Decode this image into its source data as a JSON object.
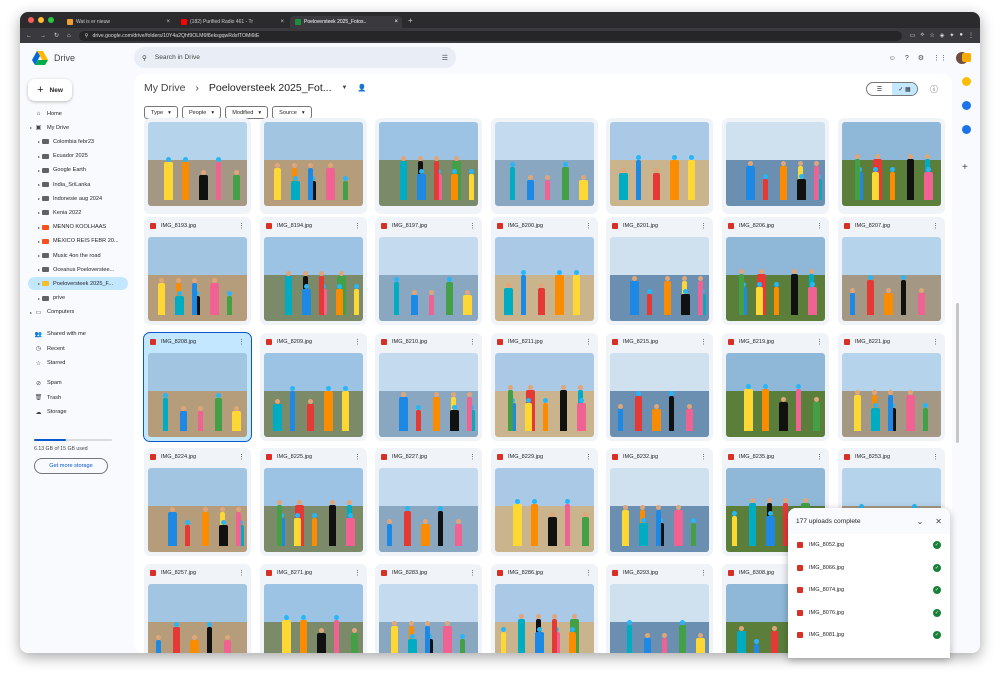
{
  "browser": {
    "tabs": [
      {
        "label": "Wat is er nieuw",
        "color": "#f0a030"
      },
      {
        "label": "(182) Purified Radio 461 - Tr",
        "color": "#ff0000"
      },
      {
        "label": "Poeloversteek 2025_Fotos..",
        "color": "#1e8e3e"
      }
    ],
    "url": "drive.google.com/drive/folders/10Y4a2Qhf9OLM6f8eksgqwRdsfTOMi6tE"
  },
  "brand": {
    "name": "Drive"
  },
  "new_button": {
    "label": "New"
  },
  "search": {
    "placeholder": "Search in Drive"
  },
  "sidebar": {
    "top": [
      {
        "label": "Home",
        "icon": "home-icon",
        "glyph": "⌂"
      },
      {
        "label": "My Drive",
        "icon": "my-drive-icon",
        "glyph": "▣"
      }
    ],
    "folders": [
      {
        "label": "Colombia febr23",
        "color": "#5f6368"
      },
      {
        "label": "Ecuador 2025",
        "color": "#5f6368"
      },
      {
        "label": "Google Earth",
        "color": "#5f6368"
      },
      {
        "label": "India_SriLanka",
        "color": "#5f6368"
      },
      {
        "label": "Indonesie aug 2024",
        "color": "#5f6368"
      },
      {
        "label": "Kenia 2022",
        "color": "#5f6368"
      },
      {
        "label": "MENNO KOOLHAAS",
        "color": "#f4511e"
      },
      {
        "label": "MEXICO REIS FEBR 20...",
        "color": "#f4511e"
      },
      {
        "label": "Music 4on the road",
        "color": "#5f6368"
      },
      {
        "label": "Oceanus Poeloverstee...",
        "color": "#5f6368"
      },
      {
        "label": "Poeloversteek 2025_F...",
        "color": "#f6bf26"
      },
      {
        "label": "prive",
        "color": "#5f6368"
      }
    ],
    "computers": {
      "label": "Computers",
      "glyph": "▭"
    },
    "secondary": [
      {
        "label": "Shared with me",
        "icon": "shared-icon",
        "glyph": "👥"
      },
      {
        "label": "Recent",
        "icon": "clock-icon",
        "glyph": "◷"
      },
      {
        "label": "Starred",
        "icon": "star-icon",
        "glyph": "☆"
      }
    ],
    "tertiary": [
      {
        "label": "Spam",
        "icon": "spam-icon",
        "glyph": "⊘"
      },
      {
        "label": "Trash",
        "icon": "trash-icon",
        "glyph": "🗑"
      },
      {
        "label": "Storage",
        "icon": "cloud-icon",
        "glyph": "☁"
      }
    ],
    "storage_text": "6.13 GB of 15 GB used",
    "storage_used_fraction": 0.41,
    "get_more_label": "Get more storage"
  },
  "breadcrumb": {
    "root": "My Drive",
    "current": "Poeloversteek 2025_Fot..."
  },
  "filters": [
    "Type",
    "People",
    "Modified",
    "Source"
  ],
  "files_row0": [
    "",
    "",
    "",
    "",
    "",
    "",
    ""
  ],
  "files": [
    [
      "IMG_8193.jpg",
      "IMG_8194.jpg",
      "IMG_8197.jpg",
      "IMG_8200.jpg",
      "IMG_8201.jpg",
      "IMG_8206.jpg",
      "IMG_8207.jpg"
    ],
    [
      "IMG_8208.jpg",
      "IMG_8209.jpg",
      "IMG_8210.jpg",
      "IMG_8211.jpg",
      "IMG_8215.jpg",
      "IMG_8219.jpg",
      "IMG_8221.jpg"
    ],
    [
      "IMG_8224.jpg",
      "IMG_8225.jpg",
      "IMG_8227.jpg",
      "IMG_8229.jpg",
      "IMG_8232.jpg",
      "IMG_8235.jpg",
      "IMG_8253.jpg"
    ],
    [
      "IMG_8257.jpg",
      "IMG_8271.jpg",
      "IMG_8283.jpg",
      "IMG_8286.jpg",
      "IMG_8293.jpg",
      "IMG_8308.jpg",
      ""
    ]
  ],
  "uploads": {
    "title": "177 uploads complete",
    "items": [
      "IMG_8052.jpg",
      "IMG_8066.jpg",
      "IMG_8074.jpg",
      "IMG_8076.jpg",
      "IMG_8081.jpg"
    ]
  },
  "colors": {
    "accent": "#0b57d0",
    "selected": "#c2e7ff",
    "success": "#188038",
    "image_icon": "#d93025"
  }
}
